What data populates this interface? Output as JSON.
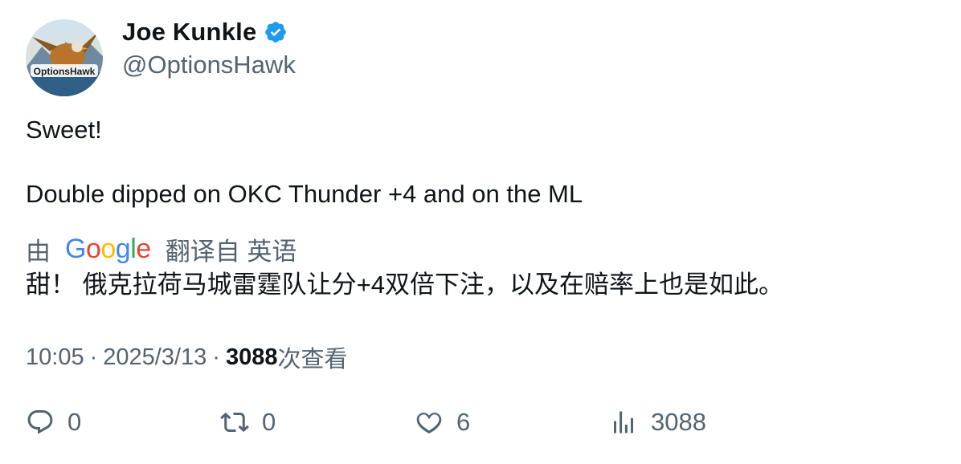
{
  "author": {
    "display_name": "Joe Kunkle",
    "handle": "@OptionsHawk",
    "verified": true,
    "avatar_text": "OptionsHawk"
  },
  "tweet": {
    "lines": [
      "Sweet!",
      "Double dipped on OKC Thunder +4 and on the ML"
    ]
  },
  "translation": {
    "prefix": "由",
    "provider": "Google",
    "suffix": "翻译自 英语",
    "text": "甜！ 俄克拉荷马城雷霆队让分+4双倍下注，以及在赔率上也是如此。"
  },
  "meta": {
    "time": "10:05",
    "date": "2025/3/13",
    "views_count": "3088",
    "views_label": "次查看",
    "separator": "·"
  },
  "actions": {
    "reply": {
      "icon": "reply-icon",
      "count": "0"
    },
    "retweet": {
      "icon": "retweet-icon",
      "count": "0"
    },
    "like": {
      "icon": "heart-icon",
      "count": "6"
    },
    "views": {
      "icon": "analytics-icon",
      "count": "3088"
    }
  },
  "colors": {
    "text": "#0f1419",
    "secondary": "#536471",
    "verified": "#1d9bf0"
  }
}
